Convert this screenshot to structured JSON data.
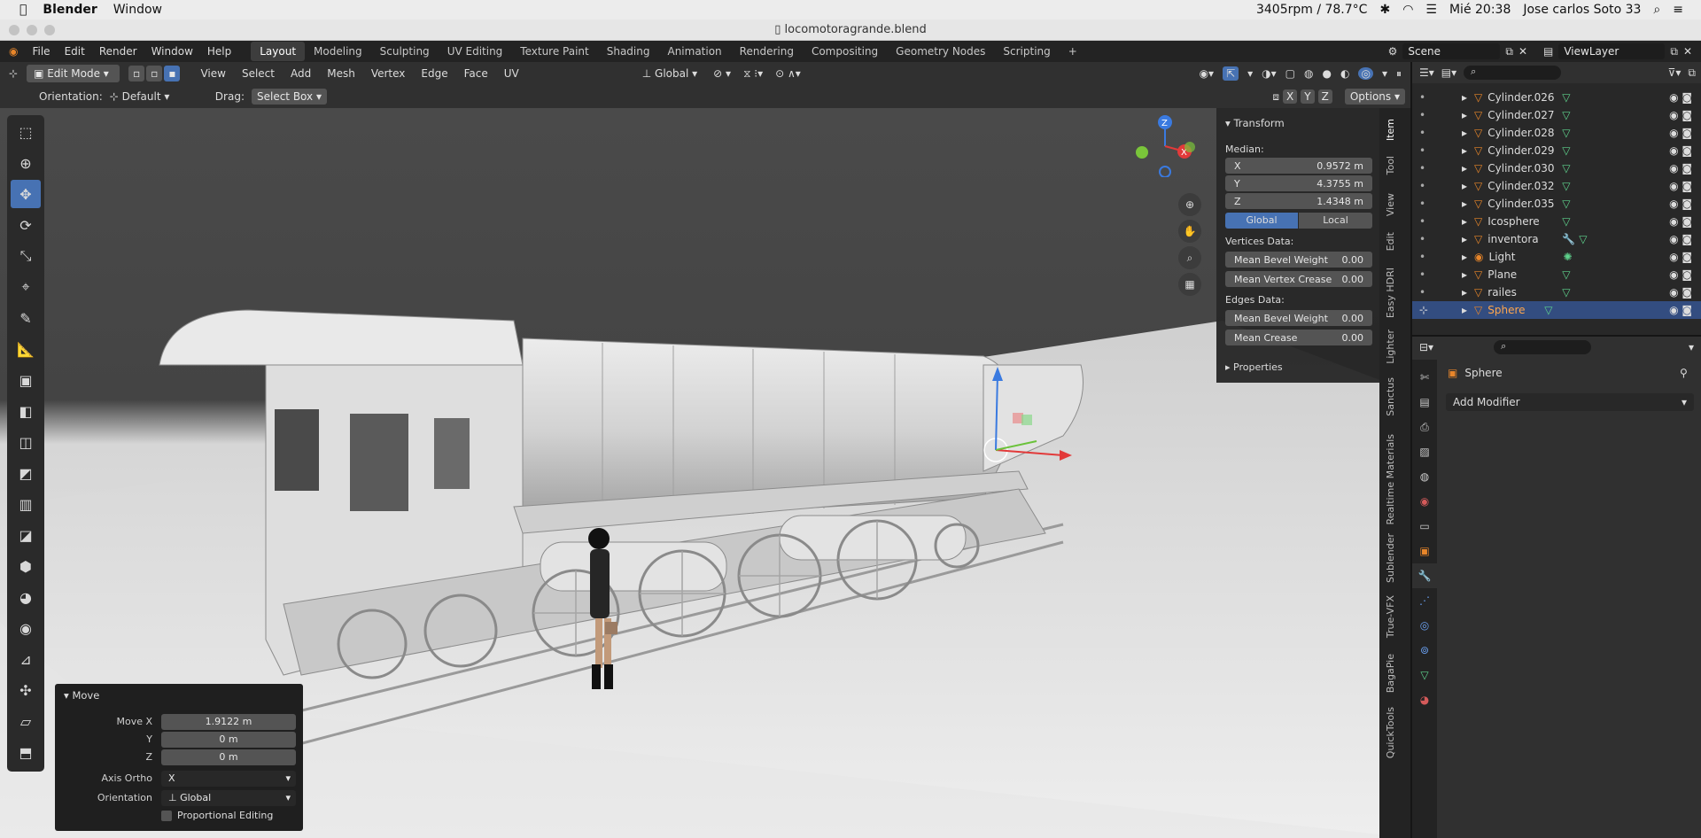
{
  "mac": {
    "app_name": "Blender",
    "menu_window": "Window",
    "fan": "3405rpm / 78.7°C",
    "datetime": "Mié 20:38",
    "user": "Jose carlos Soto 33"
  },
  "window": {
    "title": "locomotoragrande.blend"
  },
  "topbar": {
    "menus": [
      "File",
      "Edit",
      "Render",
      "Window",
      "Help"
    ],
    "workspaces": [
      "Layout",
      "Modeling",
      "Sculpting",
      "UV Editing",
      "Texture Paint",
      "Shading",
      "Animation",
      "Rendering",
      "Compositing",
      "Geometry Nodes",
      "Scripting"
    ],
    "active_workspace": "Layout",
    "scene": "Scene",
    "view_layer": "ViewLayer"
  },
  "viewport_header": {
    "mode": "Edit Mode",
    "menus": [
      "View",
      "Select",
      "Add",
      "Mesh",
      "Vertex",
      "Edge",
      "Face",
      "UV"
    ],
    "transform_orientation": "Global",
    "orientation_label": "Orientation:",
    "orientation_value": "Default",
    "drag_label": "Drag:",
    "drag_value": "Select Box",
    "axes": [
      "X",
      "Y",
      "Z"
    ],
    "options": "Options"
  },
  "npanel": {
    "transform_title": "Transform",
    "median_label": "Median:",
    "x_label": "X",
    "x_value": "0.9572 m",
    "y_label": "Y",
    "y_value": "4.3755 m",
    "z_label": "Z",
    "z_value": "1.4348 m",
    "global": "Global",
    "local": "Local",
    "vertices_data": "Vertices Data:",
    "mean_bevel_weight_v": "Mean Bevel Weight",
    "mean_bevel_weight_v_val": "0.00",
    "mean_vertex_crease": "Mean Vertex Crease",
    "mean_vertex_crease_val": "0.00",
    "edges_data": "Edges Data:",
    "mean_bevel_weight_e": "Mean Bevel Weight",
    "mean_bevel_weight_e_val": "0.00",
    "mean_crease": "Mean Crease",
    "mean_crease_val": "0.00",
    "properties": "Properties",
    "tabs": [
      "Item",
      "Tool",
      "View",
      "Edit",
      "Easy HDRI",
      "Lighter",
      "Sanctus",
      "Realtime Materials",
      "Sublender",
      "True-VFX",
      "BagaPie",
      "QuickTools"
    ]
  },
  "outliner": {
    "items": [
      "Cylinder.026",
      "Cylinder.027",
      "Cylinder.028",
      "Cylinder.029",
      "Cylinder.030",
      "Cylinder.032",
      "Cylinder.035",
      "Icosphere",
      "inventora",
      "Light",
      "Plane",
      "railes",
      "Sphere"
    ],
    "selected": "Sphere"
  },
  "properties": {
    "object_name": "Sphere",
    "add_modifier": "Add Modifier"
  },
  "move_panel": {
    "title": "Move",
    "move_x_label": "Move X",
    "move_x": "1.9122 m",
    "y_label": "Y",
    "y": "0 m",
    "z_label": "Z",
    "z": "0 m",
    "axis_ortho_label": "Axis Ortho",
    "axis_ortho": "X",
    "orientation_label": "Orientation",
    "orientation": "Global",
    "proportional": "Proportional Editing"
  },
  "colors": {
    "accent": "#4772b3",
    "selected_row": "#334d80",
    "object_orange": "#e8862a",
    "mesh_green": "#5fd38d"
  }
}
